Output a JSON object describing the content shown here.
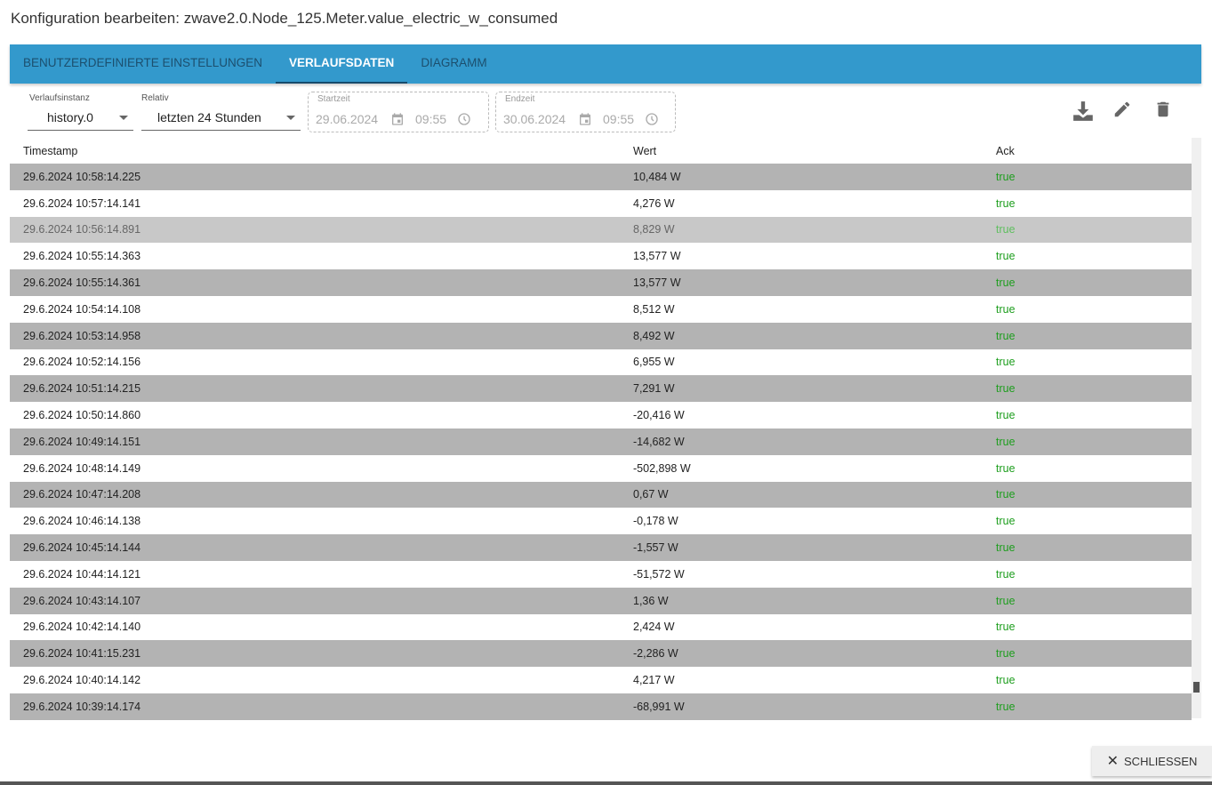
{
  "title": "Konfiguration bearbeiten: zwave2.0.Node_125.Meter.value_electric_w_consumed",
  "tabs": [
    {
      "label": "BENUTZERDEFINIERTE EINSTELLUNGEN"
    },
    {
      "label": "VERLAUFSDATEN"
    },
    {
      "label": "DIAGRAMM"
    }
  ],
  "toolbar": {
    "instance_label": "Verlaufsinstanz",
    "instance_value": "history.0",
    "relative_label": "Relativ",
    "relative_value": "letzten 24 Stunden",
    "start_label": "Startzeit",
    "start_date": "29.06.2024",
    "start_time": "09:55",
    "end_label": "Endzeit",
    "end_date": "30.06.2024",
    "end_time": "09:55"
  },
  "table": {
    "headers": [
      "Timestamp",
      "Wert",
      "Ack"
    ],
    "rows": [
      [
        "29.6.2024 10:58:14.225",
        "10,484 W",
        "true"
      ],
      [
        "29.6.2024 10:57:14.141",
        "4,276 W",
        "true"
      ],
      [
        "29.6.2024 10:56:14.891",
        "8,829 W",
        "true"
      ],
      [
        "29.6.2024 10:55:14.363",
        "13,577 W",
        "true"
      ],
      [
        "29.6.2024 10:55:14.361",
        "13,577 W",
        "true"
      ],
      [
        "29.6.2024 10:54:14.108",
        "8,512 W",
        "true"
      ],
      [
        "29.6.2024 10:53:14.958",
        "8,492 W",
        "true"
      ],
      [
        "29.6.2024 10:52:14.156",
        "6,955 W",
        "true"
      ],
      [
        "29.6.2024 10:51:14.215",
        "7,291 W",
        "true"
      ],
      [
        "29.6.2024 10:50:14.860",
        "-20,416 W",
        "true"
      ],
      [
        "29.6.2024 10:49:14.151",
        "-14,682 W",
        "true"
      ],
      [
        "29.6.2024 10:48:14.149",
        "-502,898 W",
        "true"
      ],
      [
        "29.6.2024 10:47:14.208",
        "0,67 W",
        "true"
      ],
      [
        "29.6.2024 10:46:14.138",
        "-0,178 W",
        "true"
      ],
      [
        "29.6.2024 10:45:14.144",
        "-1,557 W",
        "true"
      ],
      [
        "29.6.2024 10:44:14.121",
        "-51,572 W",
        "true"
      ],
      [
        "29.6.2024 10:43:14.107",
        "1,36 W",
        "true"
      ],
      [
        "29.6.2024 10:42:14.140",
        "2,424 W",
        "true"
      ],
      [
        "29.6.2024 10:41:15.231",
        "-2,286 W",
        "true"
      ],
      [
        "29.6.2024 10:40:14.142",
        "4,217 W",
        "true"
      ],
      [
        "29.6.2024 10:39:14.174",
        "-68,991 W",
        "true"
      ]
    ]
  },
  "close_label": "SCHLIESSEN"
}
